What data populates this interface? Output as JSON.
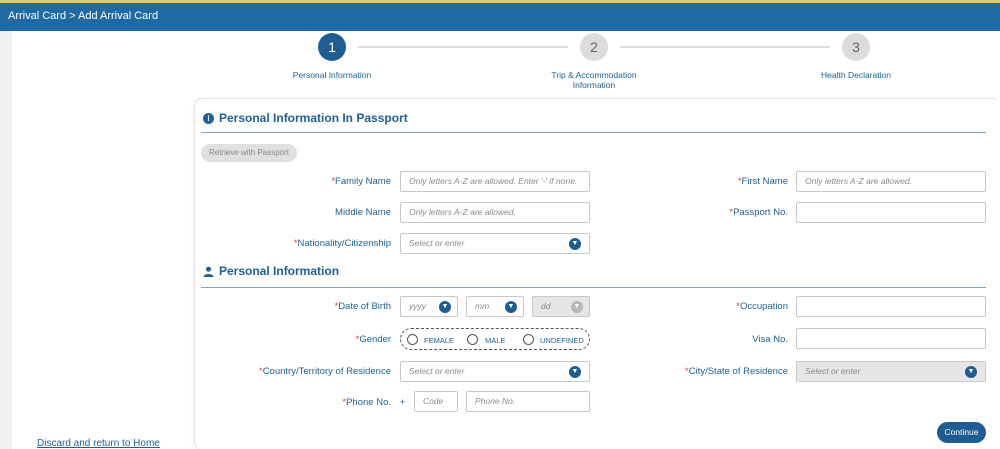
{
  "header": {
    "breadcrumb": "Arrival Card > Add Arrival Card"
  },
  "sidebar": {
    "discard_link": "Discard and return to Home"
  },
  "steps": [
    {
      "number": "1",
      "label": "Personal Information",
      "active": true
    },
    {
      "number": "2",
      "label_line1": "Trip & Accommodation",
      "label_line2": "Information",
      "active": false
    },
    {
      "number": "3",
      "label": "Health Declaration",
      "active": false
    }
  ],
  "passport_section": {
    "title": "Personal Information In Passport",
    "retrieve_button": "Retrieve with Passport",
    "family_name": {
      "label": "Family Name",
      "placeholder": "Only letters A-Z are allowed. Enter '-' if none.",
      "required": true
    },
    "first_name": {
      "label": "First Name",
      "placeholder": "Only letters A-Z are allowed.",
      "required": true
    },
    "middle_name": {
      "label": "Middle Name",
      "placeholder": "Only letters A-Z are allowed.",
      "required": false
    },
    "passport_no": {
      "label": "Passport No.",
      "placeholder": "",
      "required": true
    },
    "nationality": {
      "label": "Nationality/Citizenship",
      "placeholder": "Select or enter",
      "required": true
    }
  },
  "personal_section": {
    "title": "Personal Information",
    "dob": {
      "label": "Date of Birth",
      "yyyy": "yyyy",
      "mm": "mm",
      "dd": "dd",
      "required": true
    },
    "occupation": {
      "label": "Occupation",
      "placeholder": "",
      "required": true
    },
    "gender": {
      "label": "Gender",
      "options": [
        "FEMALE",
        "MALE",
        "UNDEFINED"
      ],
      "required": true
    },
    "visa_no": {
      "label": "Visa No.",
      "placeholder": "",
      "required": false
    },
    "country": {
      "label": "Country/Territory of Residence",
      "placeholder": "Select or enter",
      "required": true
    },
    "city": {
      "label": "City/State of Residence",
      "placeholder": "Select or enter",
      "required": true
    },
    "phone": {
      "label": "Phone No.",
      "plus": "+",
      "code_placeholder": "Code",
      "number_placeholder": "Phone No.",
      "required": true
    }
  },
  "actions": {
    "continue": "Continue"
  },
  "icons": {
    "required_marker": "*",
    "dropdown": "chevron-down-icon",
    "info": "info-icon",
    "person": "person-icon"
  },
  "colors": {
    "primary": "#1f5c92",
    "header": "#1f6aa5",
    "required": "#e53935",
    "accent_border": "#e7c86e"
  }
}
